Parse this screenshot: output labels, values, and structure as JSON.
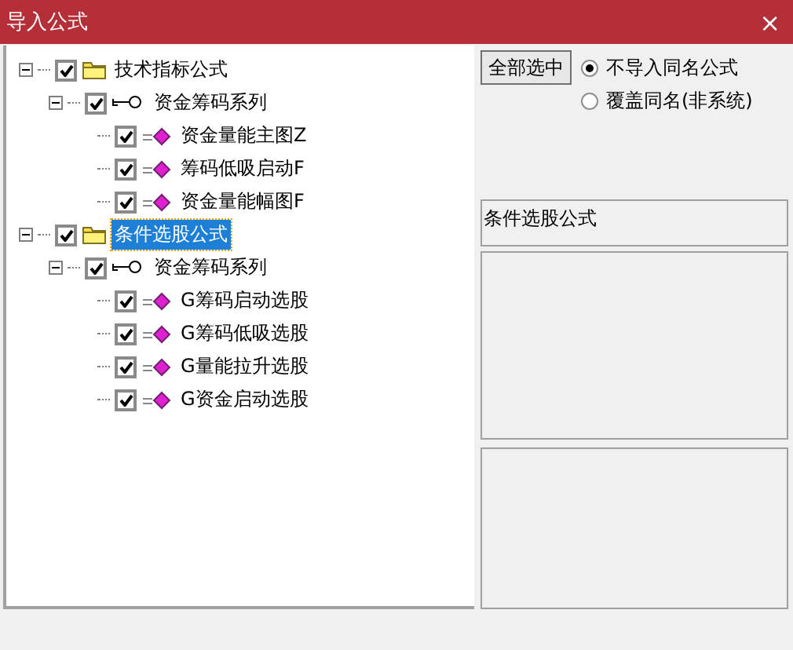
{
  "window": {
    "title": "导入公式",
    "close": "×"
  },
  "tree": [
    {
      "label": "技术指标公式",
      "kind": "folder",
      "checked": true,
      "expanded": true,
      "selected": false,
      "children": [
        {
          "label": "资金筹码系列",
          "kind": "group",
          "checked": true,
          "expanded": true,
          "selected": false,
          "children": [
            {
              "label": "资金量能主图Z",
              "kind": "formula",
              "checked": true,
              "selected": false
            },
            {
              "label": "筹码低吸启动F",
              "kind": "formula",
              "checked": true,
              "selected": false
            },
            {
              "label": "资金量能幅图F",
              "kind": "formula",
              "checked": true,
              "selected": false
            }
          ]
        }
      ]
    },
    {
      "label": "条件选股公式",
      "kind": "folder",
      "checked": true,
      "expanded": true,
      "selected": true,
      "children": [
        {
          "label": "资金筹码系列",
          "kind": "group",
          "checked": true,
          "expanded": true,
          "selected": false,
          "children": [
            {
              "label": "G筹码启动选股",
              "kind": "formula",
              "checked": true,
              "selected": false
            },
            {
              "label": "G筹码低吸选股",
              "kind": "formula",
              "checked": true,
              "selected": false
            },
            {
              "label": "G量能拉升选股",
              "kind": "formula",
              "checked": true,
              "selected": false
            },
            {
              "label": "G资金启动选股",
              "kind": "formula",
              "checked": true,
              "selected": false
            }
          ]
        }
      ]
    }
  ],
  "select_all_button": "全部选中",
  "options": [
    {
      "label": "不导入同名公式",
      "selected": true
    },
    {
      "label": "覆盖同名(非系统)",
      "selected": false
    }
  ],
  "info_box": {
    "value": "条件选股公式"
  }
}
